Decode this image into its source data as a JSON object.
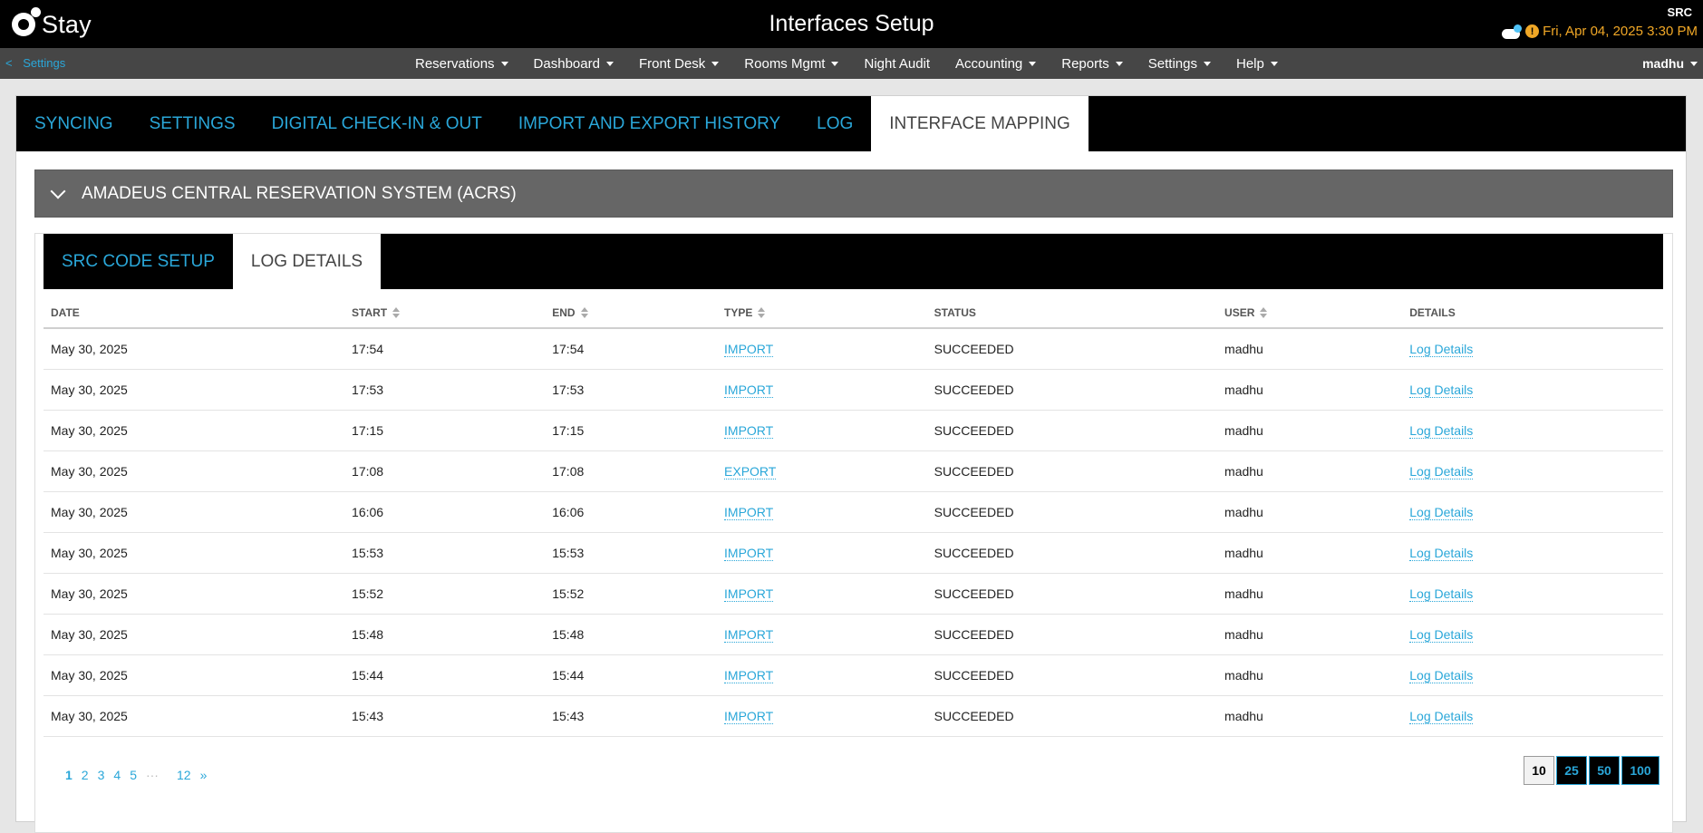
{
  "app": {
    "logo_text": "Stay",
    "page_title": "Interfaces Setup",
    "property_code": "SRC",
    "datetime": "Fri, Apr 04, 2025 3:30 PM",
    "alert_glyph": "!",
    "accent_color": "#2aa7d9",
    "date_color": "#f0a726"
  },
  "nav": {
    "back_label": "Settings",
    "back_glyph": "<",
    "items": [
      {
        "label": "Reservations",
        "dropdown": true
      },
      {
        "label": "Dashboard",
        "dropdown": true
      },
      {
        "label": "Front Desk",
        "dropdown": true
      },
      {
        "label": "Rooms Mgmt",
        "dropdown": true
      },
      {
        "label": "Night Audit",
        "dropdown": false
      },
      {
        "label": "Accounting",
        "dropdown": true
      },
      {
        "label": "Reports",
        "dropdown": true
      },
      {
        "label": "Settings",
        "dropdown": true
      },
      {
        "label": "Help",
        "dropdown": true
      }
    ],
    "user": "madhu"
  },
  "main_tabs": [
    {
      "label": "SYNCING",
      "active": false
    },
    {
      "label": "SETTINGS",
      "active": false
    },
    {
      "label": "DIGITAL CHECK-IN & OUT",
      "active": false
    },
    {
      "label": "IMPORT AND EXPORT HISTORY",
      "active": false
    },
    {
      "label": "LOG",
      "active": false
    },
    {
      "label": "INTERFACE MAPPING",
      "active": true
    }
  ],
  "section": {
    "title": "AMADEUS CENTRAL RESERVATION SYSTEM (ACRS)"
  },
  "sub_tabs": [
    {
      "label": "SRC CODE SETUP",
      "active": false
    },
    {
      "label": "LOG DETAILS",
      "active": true
    }
  ],
  "table": {
    "columns": [
      {
        "label": "DATE",
        "sortable": false
      },
      {
        "label": "START",
        "sortable": true
      },
      {
        "label": "END",
        "sortable": true
      },
      {
        "label": "TYPE",
        "sortable": true
      },
      {
        "label": "STATUS",
        "sortable": false
      },
      {
        "label": "USER",
        "sortable": true
      },
      {
        "label": "DETAILS",
        "sortable": false
      }
    ],
    "rows": [
      {
        "date": "May 30, 2025",
        "start": "17:54",
        "end": "17:54",
        "type": "IMPORT",
        "status": "SUCCEEDED",
        "user": "madhu",
        "details": "Log Details"
      },
      {
        "date": "May 30, 2025",
        "start": "17:53",
        "end": "17:53",
        "type": "IMPORT",
        "status": "SUCCEEDED",
        "user": "madhu",
        "details": "Log Details"
      },
      {
        "date": "May 30, 2025",
        "start": "17:15",
        "end": "17:15",
        "type": "IMPORT",
        "status": "SUCCEEDED",
        "user": "madhu",
        "details": "Log Details"
      },
      {
        "date": "May 30, 2025",
        "start": "17:08",
        "end": "17:08",
        "type": "EXPORT",
        "status": "SUCCEEDED",
        "user": "madhu",
        "details": "Log Details"
      },
      {
        "date": "May 30, 2025",
        "start": "16:06",
        "end": "16:06",
        "type": "IMPORT",
        "status": "SUCCEEDED",
        "user": "madhu",
        "details": "Log Details"
      },
      {
        "date": "May 30, 2025",
        "start": "15:53",
        "end": "15:53",
        "type": "IMPORT",
        "status": "SUCCEEDED",
        "user": "madhu",
        "details": "Log Details"
      },
      {
        "date": "May 30, 2025",
        "start": "15:52",
        "end": "15:52",
        "type": "IMPORT",
        "status": "SUCCEEDED",
        "user": "madhu",
        "details": "Log Details"
      },
      {
        "date": "May 30, 2025",
        "start": "15:48",
        "end": "15:48",
        "type": "IMPORT",
        "status": "SUCCEEDED",
        "user": "madhu",
        "details": "Log Details"
      },
      {
        "date": "May 30, 2025",
        "start": "15:44",
        "end": "15:44",
        "type": "IMPORT",
        "status": "SUCCEEDED",
        "user": "madhu",
        "details": "Log Details"
      },
      {
        "date": "May 30, 2025",
        "start": "15:43",
        "end": "15:43",
        "type": "IMPORT",
        "status": "SUCCEEDED",
        "user": "madhu",
        "details": "Log Details"
      }
    ]
  },
  "pagination": {
    "pages": [
      "1",
      "2",
      "3",
      "4",
      "5"
    ],
    "current": "1",
    "ellipsis": "···",
    "last": "12",
    "next": "»"
  },
  "page_size": {
    "options": [
      "10",
      "25",
      "50",
      "100"
    ],
    "selected": "10"
  }
}
